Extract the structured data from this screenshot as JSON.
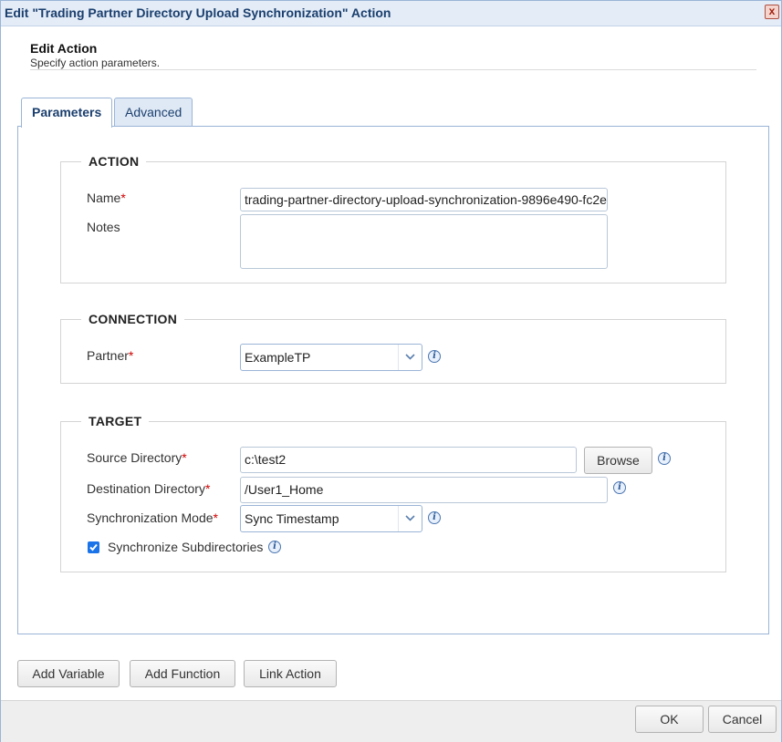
{
  "window": {
    "title": "Edit \"Trading Partner Directory Upload Synchronization\" Action",
    "close_glyph": "x"
  },
  "header": {
    "title": "Edit Action",
    "subtitle": "Specify action parameters."
  },
  "tabs": [
    {
      "label": "Parameters",
      "active": true
    },
    {
      "label": "Advanced",
      "active": false
    }
  ],
  "action_section": {
    "legend": "ACTION",
    "name_label": "Name",
    "name_value": "trading-partner-directory-upload-synchronization-9896e490-fc2e",
    "notes_label": "Notes",
    "notes_value": ""
  },
  "connection_section": {
    "legend": "CONNECTION",
    "partner_label": "Partner",
    "partner_value": "ExampleTP"
  },
  "target_section": {
    "legend": "TARGET",
    "source_label": "Source Directory",
    "source_value": "c:\\test2",
    "browse_label": "Browse",
    "dest_label": "Destination Directory",
    "dest_value": "/User1_Home",
    "mode_label": "Synchronization Mode",
    "mode_value": "Sync Timestamp",
    "subdirs_label": "Synchronize Subdirectories",
    "subdirs_checked": true
  },
  "required_marker": "*",
  "info_glyph": "i",
  "bottom_buttons": {
    "add_variable": "Add Variable",
    "add_function": "Add Function",
    "link_action": "Link Action"
  },
  "footer": {
    "ok": "OK",
    "cancel": "Cancel"
  },
  "colors": {
    "accent": "#1b3f6e",
    "border": "#9ab4d6",
    "required": "#d00000",
    "checkbox": "#1a73e8"
  }
}
